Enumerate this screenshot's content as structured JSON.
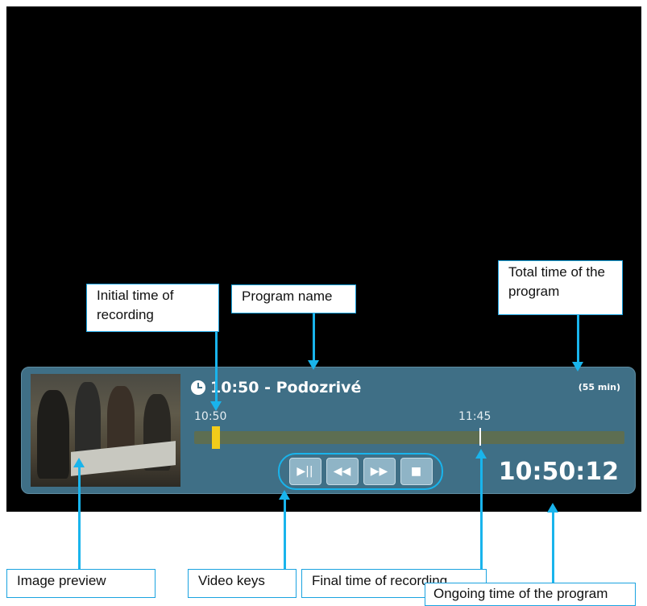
{
  "osd": {
    "program_title": "10:50 - Podozrivé",
    "duration": "(55 min)",
    "start_time": "10:50",
    "end_time": "11:45",
    "current_time": "10:50:12",
    "keys": [
      "▶||",
      "◀◀",
      "▶▶",
      "■"
    ]
  },
  "callouts": {
    "initial_time": "Initial time of recording",
    "program_name": "Program name",
    "total_time": "Total time of the program",
    "image_preview": "Image preview",
    "video_keys": "Video keys",
    "final_time": "Final time of recording",
    "ongoing_time": "Ongoing time of the program"
  },
  "colors": {
    "accent": "#19b4ec",
    "osd_bg": "#3f6f86",
    "marker": "#f2cc1a"
  }
}
